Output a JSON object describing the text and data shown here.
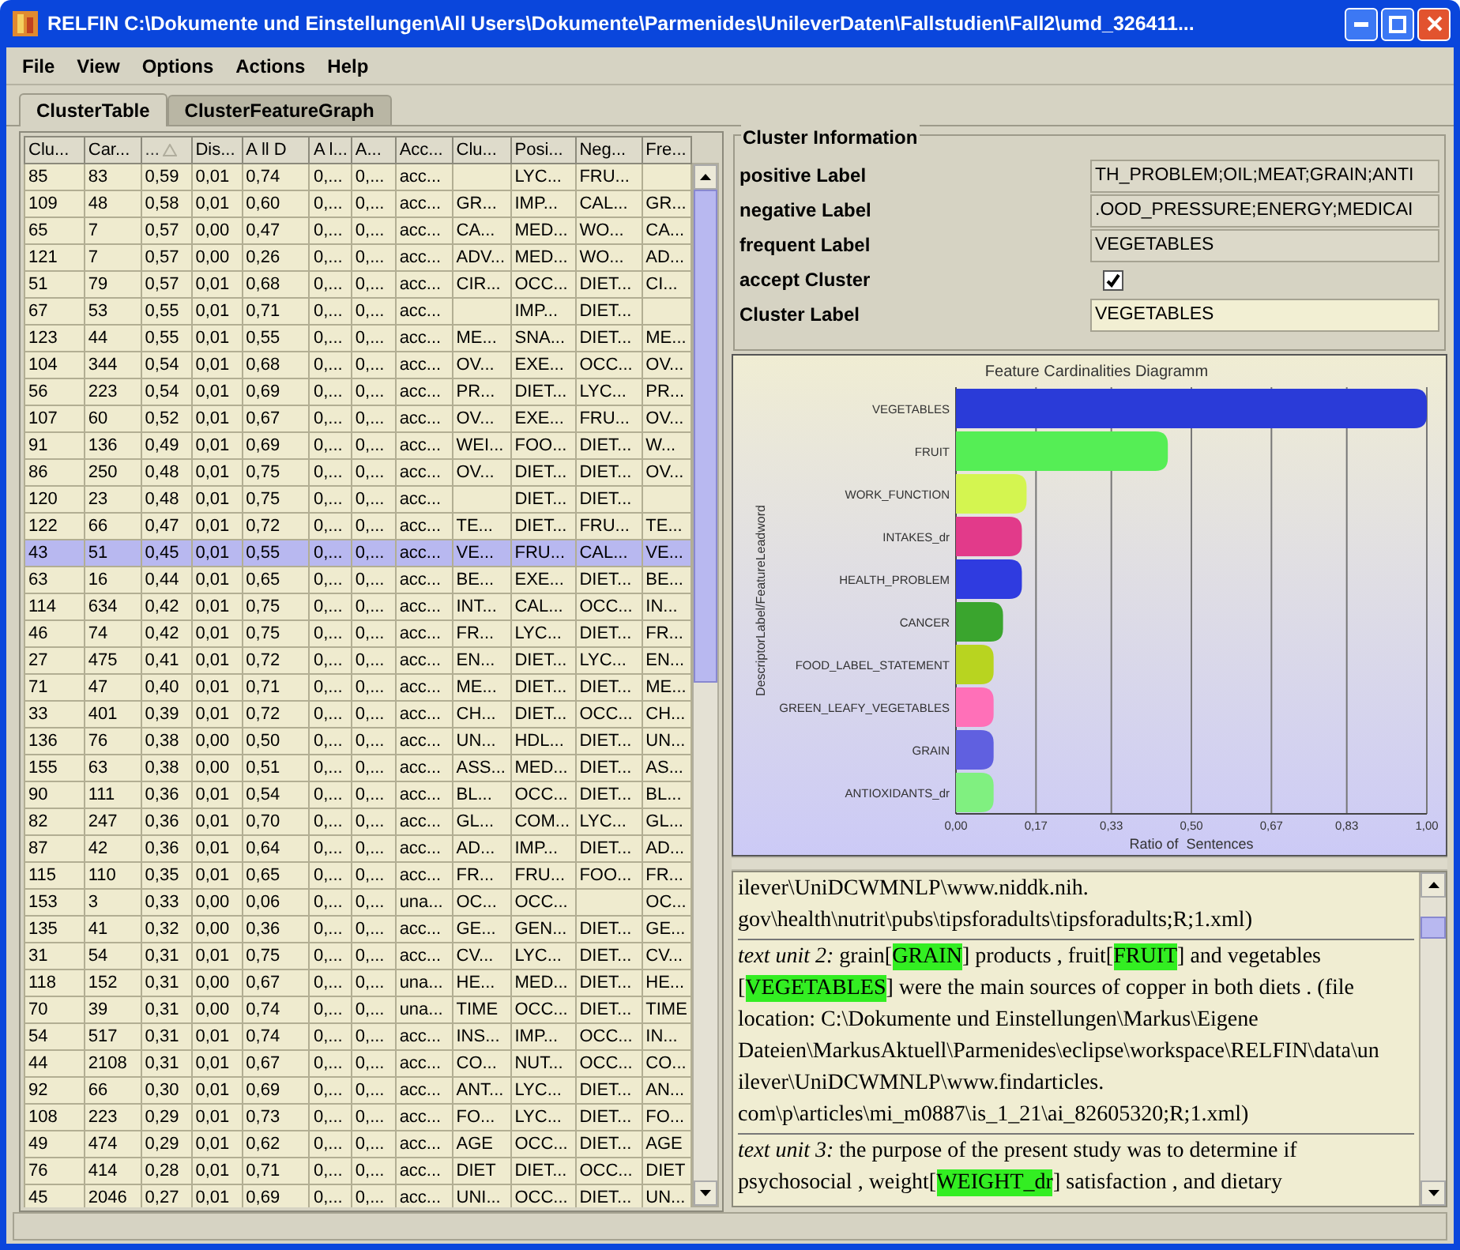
{
  "window": {
    "title": "RELFIN C:\\Dokumente und Einstellungen\\All Users\\Dokumente\\Parmenides\\UnileverDaten\\Fallstudien\\Fall2\\umd_326411..."
  },
  "menu": [
    "File",
    "View",
    "Options",
    "Actions",
    "Help"
  ],
  "tabs": [
    {
      "label": "ClusterTable",
      "selected": true
    },
    {
      "label": "ClusterFeatureGraph",
      "selected": false
    }
  ],
  "table": {
    "columns": [
      {
        "label": "Clu...",
        "sorted": false
      },
      {
        "label": "Car...",
        "sorted": false
      },
      {
        "label": "...",
        "sorted": true
      },
      {
        "label": "Dis...",
        "sorted": false
      },
      {
        "label": "A ll D",
        "sorted": false
      },
      {
        "label": "A l...",
        "sorted": false
      },
      {
        "label": "A...",
        "sorted": false
      },
      {
        "label": "Acc...",
        "sorted": false
      },
      {
        "label": "Clu...",
        "sorted": false
      },
      {
        "label": "Posi...",
        "sorted": false
      },
      {
        "label": "Neg...",
        "sorted": false
      },
      {
        "label": "Fre...",
        "sorted": false
      }
    ],
    "rows": [
      {
        "selected": false,
        "cells": [
          "85",
          "83",
          "0,59",
          "0,01",
          "0,74",
          "0,...",
          "0,...",
          "acc...",
          null,
          "LYC...",
          "FRU...",
          null
        ]
      },
      {
        "selected": false,
        "cells": [
          "109",
          "48",
          "0,58",
          "0,01",
          "0,60",
          "0,...",
          "0,...",
          "acc...",
          "GR...",
          "IMP...",
          "CAL...",
          "GR..."
        ]
      },
      {
        "selected": false,
        "cells": [
          "65",
          "7",
          "0,57",
          "0,00",
          "0,47",
          "0,...",
          "0,...",
          "acc...",
          "CA...",
          "MED...",
          "WO...",
          "CA..."
        ]
      },
      {
        "selected": false,
        "cells": [
          "121",
          "7",
          "0,57",
          "0,00",
          "0,26",
          "0,...",
          "0,...",
          "acc...",
          "ADV...",
          "MED...",
          "WO...",
          "AD..."
        ]
      },
      {
        "selected": false,
        "cells": [
          "51",
          "79",
          "0,57",
          "0,01",
          "0,68",
          "0,...",
          "0,...",
          "acc...",
          "CIR...",
          "OCC...",
          "DIET...",
          "CI..."
        ]
      },
      {
        "selected": false,
        "cells": [
          "67",
          "53",
          "0,55",
          "0,01",
          "0,71",
          "0,...",
          "0,...",
          "acc...",
          null,
          "IMP...",
          "DIET...",
          null
        ]
      },
      {
        "selected": false,
        "cells": [
          "123",
          "44",
          "0,55",
          "0,01",
          "0,55",
          "0,...",
          "0,...",
          "acc...",
          "ME...",
          "SNA...",
          "DIET...",
          "ME..."
        ]
      },
      {
        "selected": false,
        "cells": [
          "104",
          "344",
          "0,54",
          "0,01",
          "0,68",
          "0,...",
          "0,...",
          "acc...",
          "OV...",
          "EXE...",
          "OCC...",
          "OV..."
        ]
      },
      {
        "selected": false,
        "cells": [
          "56",
          "223",
          "0,54",
          "0,01",
          "0,69",
          "0,...",
          "0,...",
          "acc...",
          "PR...",
          "DIET...",
          "LYC...",
          "PR..."
        ]
      },
      {
        "selected": false,
        "cells": [
          "107",
          "60",
          "0,52",
          "0,01",
          "0,67",
          "0,...",
          "0,...",
          "acc...",
          "OV...",
          "EXE...",
          "FRU...",
          "OV..."
        ]
      },
      {
        "selected": false,
        "cells": [
          "91",
          "136",
          "0,49",
          "0,01",
          "0,69",
          "0,...",
          "0,...",
          "acc...",
          "WEI...",
          "FOO...",
          "DIET...",
          "W..."
        ]
      },
      {
        "selected": false,
        "cells": [
          "86",
          "250",
          "0,48",
          "0,01",
          "0,75",
          "0,...",
          "0,...",
          "acc...",
          "OV...",
          "DIET...",
          "DIET...",
          "OV..."
        ]
      },
      {
        "selected": false,
        "cells": [
          "120",
          "23",
          "0,48",
          "0,01",
          "0,75",
          "0,...",
          "0,...",
          "acc...",
          null,
          "DIET...",
          "DIET...",
          null
        ]
      },
      {
        "selected": false,
        "cells": [
          "122",
          "66",
          "0,47",
          "0,01",
          "0,72",
          "0,...",
          "0,...",
          "acc...",
          "TE...",
          "DIET...",
          "FRU...",
          "TE..."
        ]
      },
      {
        "selected": true,
        "cells": [
          "43",
          "51",
          "0,45",
          "0,01",
          "0,55",
          "0,...",
          "0,...",
          "acc...",
          "VE...",
          "FRU...",
          "CAL...",
          "VE..."
        ]
      },
      {
        "selected": false,
        "cells": [
          "63",
          "16",
          "0,44",
          "0,01",
          "0,65",
          "0,...",
          "0,...",
          "acc...",
          "BE...",
          "EXE...",
          "DIET...",
          "BE..."
        ]
      },
      {
        "selected": false,
        "cells": [
          "114",
          "634",
          "0,42",
          "0,01",
          "0,75",
          "0,...",
          "0,...",
          "acc...",
          "INT...",
          "CAL...",
          "OCC...",
          "IN..."
        ]
      },
      {
        "selected": false,
        "cells": [
          "46",
          "74",
          "0,42",
          "0,01",
          "0,75",
          "0,...",
          "0,...",
          "acc...",
          "FR...",
          "LYC...",
          "DIET...",
          "FR..."
        ]
      },
      {
        "selected": false,
        "cells": [
          "27",
          "475",
          "0,41",
          "0,01",
          "0,72",
          "0,...",
          "0,...",
          "acc...",
          "EN...",
          "DIET...",
          "LYC...",
          "EN..."
        ]
      },
      {
        "selected": false,
        "cells": [
          "71",
          "47",
          "0,40",
          "0,01",
          "0,71",
          "0,...",
          "0,...",
          "acc...",
          "ME...",
          "DIET...",
          "DIET...",
          "ME..."
        ]
      },
      {
        "selected": false,
        "cells": [
          "33",
          "401",
          "0,39",
          "0,01",
          "0,72",
          "0,...",
          "0,...",
          "acc...",
          "CH...",
          "DIET...",
          "OCC...",
          "CH..."
        ]
      },
      {
        "selected": false,
        "cells": [
          "136",
          "76",
          "0,38",
          "0,00",
          "0,50",
          "0,...",
          "0,...",
          "acc...",
          "UN...",
          "HDL...",
          "DIET...",
          "UN..."
        ]
      },
      {
        "selected": false,
        "cells": [
          "155",
          "63",
          "0,38",
          "0,00",
          "0,51",
          "0,...",
          "0,...",
          "acc...",
          "ASS...",
          "MED...",
          "DIET...",
          "AS..."
        ]
      },
      {
        "selected": false,
        "cells": [
          "90",
          "111",
          "0,36",
          "0,01",
          "0,54",
          "0,...",
          "0,...",
          "acc...",
          "BL...",
          "OCC...",
          "DIET...",
          "BL..."
        ]
      },
      {
        "selected": false,
        "cells": [
          "82",
          "247",
          "0,36",
          "0,01",
          "0,70",
          "0,...",
          "0,...",
          "acc...",
          "GL...",
          "COM...",
          "LYC...",
          "GL..."
        ]
      },
      {
        "selected": false,
        "cells": [
          "87",
          "42",
          "0,36",
          "0,01",
          "0,64",
          "0,...",
          "0,...",
          "acc...",
          "AD...",
          "IMP...",
          "DIET...",
          "AD..."
        ]
      },
      {
        "selected": false,
        "cells": [
          "115",
          "110",
          "0,35",
          "0,01",
          "0,65",
          "0,...",
          "0,...",
          "acc...",
          "FR...",
          "FRU...",
          "FOO...",
          "FR..."
        ]
      },
      {
        "selected": false,
        "cells": [
          "153",
          "3",
          "0,33",
          "0,00",
          "0,06",
          "0,...",
          "0,...",
          "una...",
          "OC...",
          "OCC...",
          null,
          "OC..."
        ]
      },
      {
        "selected": false,
        "cells": [
          "135",
          "41",
          "0,32",
          "0,00",
          "0,36",
          "0,...",
          "0,...",
          "acc...",
          "GE...",
          "GEN...",
          "DIET...",
          "GE..."
        ]
      },
      {
        "selected": false,
        "cells": [
          "31",
          "54",
          "0,31",
          "0,01",
          "0,75",
          "0,...",
          "0,...",
          "acc...",
          "CV...",
          "LYC...",
          "DIET...",
          "CV..."
        ]
      },
      {
        "selected": false,
        "cells": [
          "118",
          "152",
          "0,31",
          "0,00",
          "0,67",
          "0,...",
          "0,...",
          "una...",
          "HE...",
          "MED...",
          "DIET...",
          "HE..."
        ]
      },
      {
        "selected": false,
        "cells": [
          "70",
          "39",
          "0,31",
          "0,00",
          "0,74",
          "0,...",
          "0,...",
          "una...",
          "TIME",
          "OCC...",
          "DIET...",
          "TIME"
        ]
      },
      {
        "selected": false,
        "cells": [
          "54",
          "517",
          "0,31",
          "0,01",
          "0,74",
          "0,...",
          "0,...",
          "acc...",
          "INS...",
          "IMP...",
          "OCC...",
          "IN..."
        ]
      },
      {
        "selected": false,
        "cells": [
          "44",
          "2108",
          "0,31",
          "0,01",
          "0,67",
          "0,...",
          "0,...",
          "acc...",
          "CO...",
          "NUT...",
          "OCC...",
          "CO..."
        ]
      },
      {
        "selected": false,
        "cells": [
          "92",
          "66",
          "0,30",
          "0,01",
          "0,69",
          "0,...",
          "0,...",
          "acc...",
          "ANT...",
          "LYC...",
          "DIET...",
          "AN..."
        ]
      },
      {
        "selected": false,
        "cells": [
          "108",
          "223",
          "0,29",
          "0,01",
          "0,73",
          "0,...",
          "0,...",
          "acc...",
          "FO...",
          "LYC...",
          "DIET...",
          "FO..."
        ]
      },
      {
        "selected": false,
        "cells": [
          "49",
          "474",
          "0,29",
          "0,01",
          "0,62",
          "0,...",
          "0,...",
          "acc...",
          "AGE",
          "OCC...",
          "DIET...",
          "AGE"
        ]
      },
      {
        "selected": false,
        "cells": [
          "76",
          "414",
          "0,28",
          "0,01",
          "0,71",
          "0,...",
          "0,...",
          "acc...",
          "DIET",
          "DIET...",
          "OCC...",
          "DIET"
        ]
      },
      {
        "selected": false,
        "cells": [
          "45",
          "2046",
          "0,27",
          "0,01",
          "0,69",
          "0,...",
          "0,...",
          "acc...",
          "UNI...",
          "OCC...",
          "DIET...",
          "UN..."
        ]
      }
    ]
  },
  "cluster_information": {
    "title": "Cluster Information",
    "fields": [
      {
        "kind": "readonly",
        "label": "positive Label",
        "value": "TH_PROBLEM;OIL;MEAT;GRAIN;ANTI"
      },
      {
        "kind": "readonly",
        "label": "negative Label",
        "value": ".OOD_PRESSURE;ENERGY;MEDICAI"
      },
      {
        "kind": "readonly",
        "label": "frequent Label",
        "value": "VEGETABLES"
      },
      {
        "kind": "checkbox",
        "label": "accept Cluster",
        "checked": true
      },
      {
        "kind": "editable",
        "label": "Cluster Label",
        "value": "VEGETABLES"
      }
    ]
  },
  "chart": {
    "chart_data": {
      "type": "bar",
      "orientation": "horizontal",
      "title": "Feature Cardinalities Diagramm",
      "xlabel": "Ratio of  Sentences",
      "ylabel": "DescriptorLabel/FeatureLeadword",
      "categories": [
        "VEGETABLES",
        "FRUIT",
        "WORK_FUNCTION",
        "INTAKES_dr",
        "HEALTH_PROBLEM",
        "CANCER",
        "FOOD_LABEL_STATEMENT",
        "GREEN_LEAFY_VEGETABLES",
        "GRAIN",
        "ANTIOXIDANTS_dr"
      ],
      "values": [
        1.0,
        0.45,
        0.15,
        0.14,
        0.14,
        0.1,
        0.08,
        0.08,
        0.08,
        0.08
      ],
      "xlim": [
        0,
        1
      ],
      "grid": true,
      "xticks": [
        {
          "value": 0,
          "label": "0,00"
        },
        {
          "value": 0.17,
          "label": "0,17"
        },
        {
          "value": 0.33,
          "label": "0,33"
        },
        {
          "value": 0.5,
          "label": "0,50"
        },
        {
          "value": 0.67,
          "label": "0,67"
        },
        {
          "value": 0.83,
          "label": "0,83"
        },
        {
          "value": 1,
          "label": "1,00"
        }
      ]
    }
  },
  "text_units": [
    {
      "lines": [
        [
          {
            "kind": "plain",
            "text": "ilever\\UniDCWMNLP\\www.niddk.nih."
          }
        ],
        [
          {
            "kind": "plain",
            "text": "gov\\health\\nutrit\\pubs\\tipsforadults\\tipsforadults;R;1.xml)"
          }
        ]
      ]
    },
    {
      "lines": [
        [
          {
            "kind": "label",
            "text": "text unit 2:"
          },
          {
            "kind": "plain",
            "text": " grain["
          },
          {
            "kind": "tag",
            "text": "GRAIN"
          },
          {
            "kind": "plain",
            "text": "] products , fruit["
          },
          {
            "kind": "tag",
            "text": "FRUIT"
          },
          {
            "kind": "plain",
            "text": "] and vegetables"
          }
        ],
        [
          {
            "kind": "plain",
            "text": "["
          },
          {
            "kind": "tag",
            "text": "VEGETABLES"
          },
          {
            "kind": "plain",
            "text": "] were the main sources of copper in both diets . (file"
          }
        ],
        [
          {
            "kind": "plain",
            "text": "location: C:\\Dokumente und Einstellungen\\Markus\\Eigene"
          }
        ],
        [
          {
            "kind": "plain",
            "text": "Dateien\\MarkusAktuell\\Parmenides\\eclipse\\workspace\\RELFIN\\data\\un"
          }
        ],
        [
          {
            "kind": "plain",
            "text": "ilever\\UniDCWMNLP\\www.findarticles."
          }
        ],
        [
          {
            "kind": "plain",
            "text": "com\\p\\articles\\mi_m0887\\is_1_21\\ai_82605320;R;1.xml)"
          }
        ]
      ]
    },
    {
      "lines": [
        [
          {
            "kind": "label",
            "text": "text unit 3:"
          },
          {
            "kind": "plain",
            "text": " the purpose of the present study was to determine if"
          }
        ],
        [
          {
            "kind": "plain",
            "text": "psychosocial , weight["
          },
          {
            "kind": "tag",
            "text": "WEIGHT_dr"
          },
          {
            "kind": "plain",
            "text": "] satisfaction , and dietary"
          }
        ]
      ]
    }
  ]
}
